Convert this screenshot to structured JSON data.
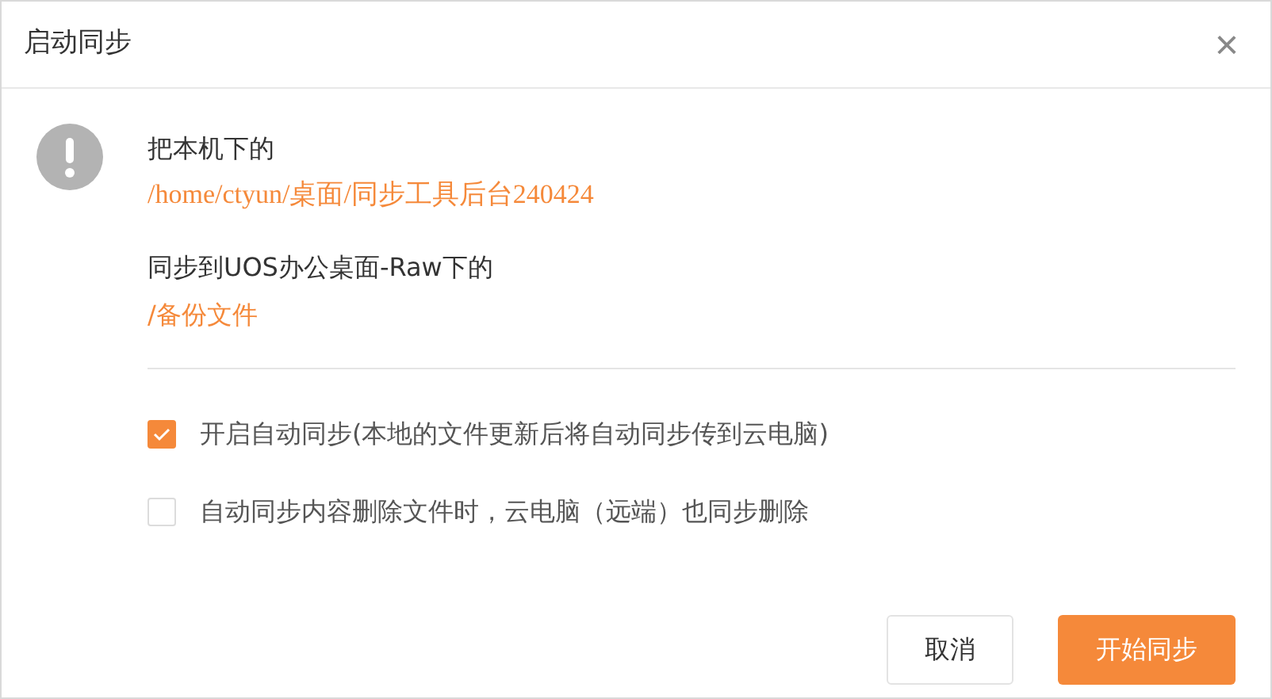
{
  "window": {
    "title": "启动同步",
    "close": "×"
  },
  "message": {
    "source_label": "把本机下的",
    "source_path": "/home/ctyun/桌面/同步工具后台240424",
    "target_label": "同步到UOS办公桌面-Raw下的",
    "target_path": "/备份文件"
  },
  "options": [
    {
      "label": "开启自动同步(本地的文件更新后将自动同步传到云电脑)",
      "checked": true
    },
    {
      "label": "自动同步内容删除文件时，云电脑（远端）也同步删除",
      "checked": false
    }
  ],
  "buttons": [
    {
      "label": "取消",
      "kind": "secondary"
    },
    {
      "label": "开始同步",
      "kind": "primary"
    }
  ]
}
